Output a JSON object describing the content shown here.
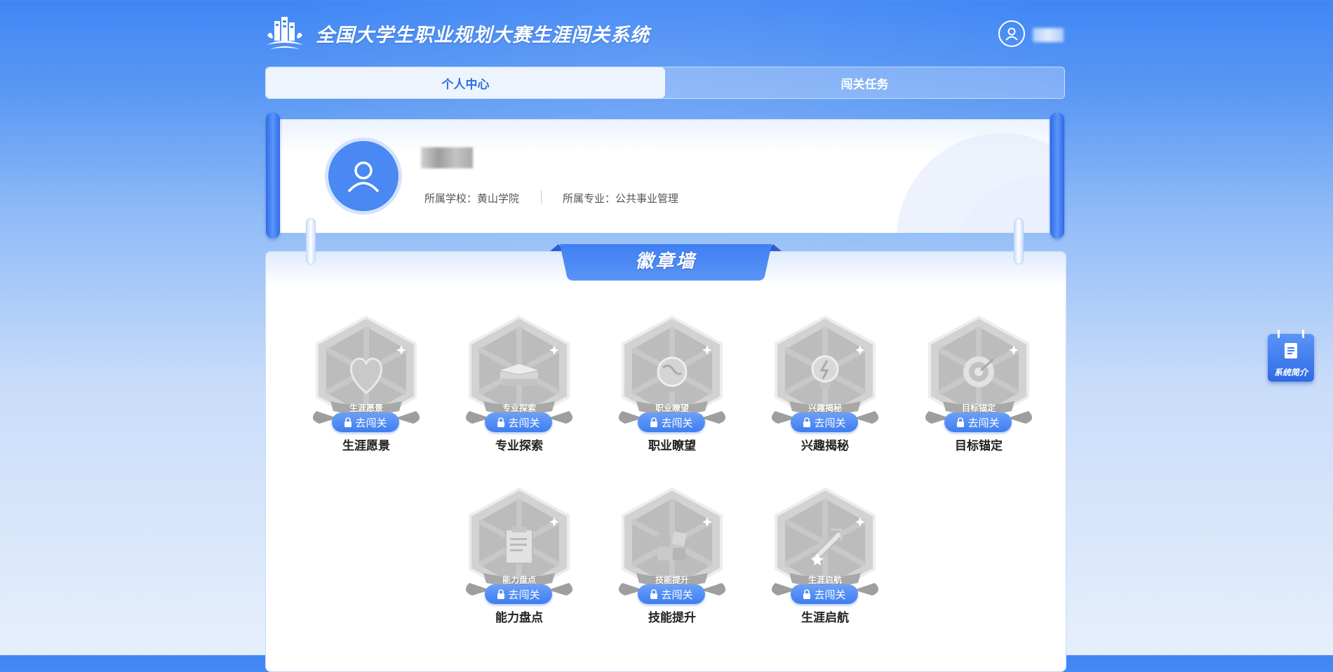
{
  "header": {
    "title": "全国大学生职业规划大赛生涯闯关系统",
    "logo_icon": "city-logo-icon",
    "user_icon": "user-icon"
  },
  "tabs": [
    {
      "label": "个人中心",
      "active": true
    },
    {
      "label": "闯关任务",
      "active": false
    }
  ],
  "profile": {
    "avatar_icon": "user-icon",
    "school": "所属学校：黄山学院",
    "major": "所属专业：公共事业管理"
  },
  "badge_wall": {
    "title": "徽章墙",
    "button_label": "去闯关",
    "lock_icon": "lock-icon",
    "badges": [
      {
        "caption": "生涯愿景",
        "label": "生涯愿景",
        "icon": "heart-icon"
      },
      {
        "caption": "专业探索",
        "label": "专业探索",
        "icon": "book-icon"
      },
      {
        "caption": "职业瞭望",
        "label": "职业瞭望",
        "icon": "globe-icon"
      },
      {
        "caption": "兴趣揭秘",
        "label": "兴趣揭秘",
        "icon": "lightbulb-icon"
      },
      {
        "caption": "目标锚定",
        "label": "目标锚定",
        "icon": "target-icon"
      },
      {
        "caption": "能力盘点",
        "label": "能力盘点",
        "icon": "clipboard-icon"
      },
      {
        "caption": "技能提升",
        "label": "技能提升",
        "icon": "blocks-icon"
      },
      {
        "caption": "生涯启航",
        "label": "生涯启航",
        "icon": "rocket-icon"
      }
    ]
  },
  "float_intro": {
    "label": "系统简介",
    "icon": "document-icon"
  },
  "colors": {
    "primary": "#3d7ef0",
    "tab_active_text": "#2f6fe6",
    "bg_top": "#3f86f5"
  }
}
